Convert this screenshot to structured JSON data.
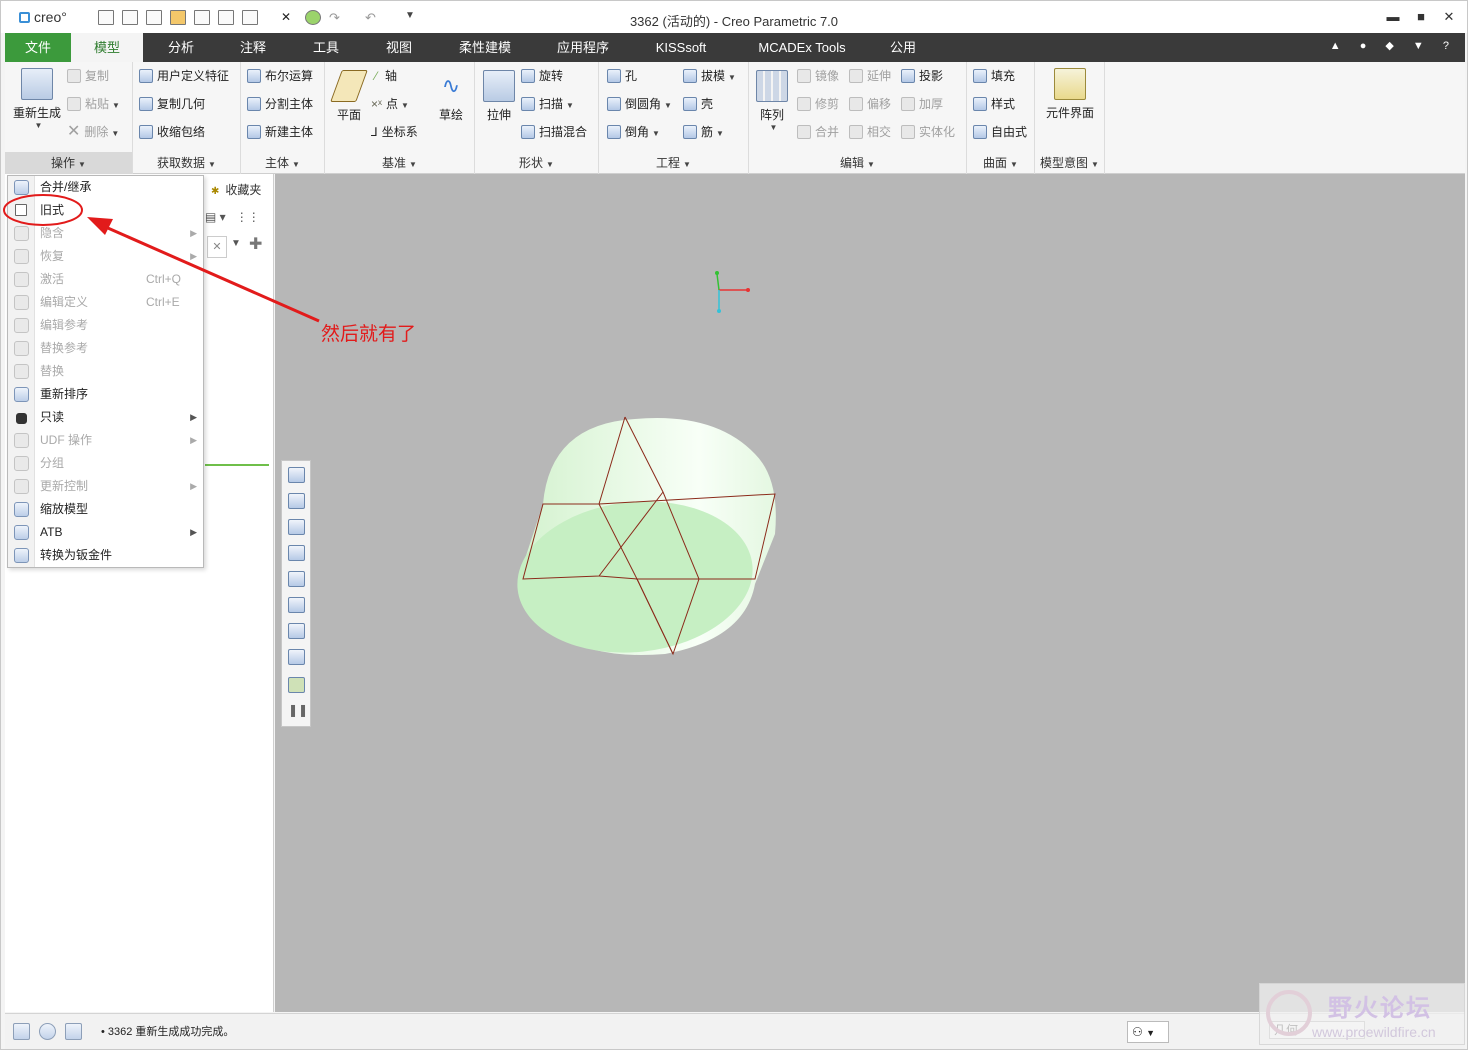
{
  "titlebar": {
    "logo": "creo°",
    "title": "3362 (活动的) - Creo Parametric 7.0",
    "minimize": "▬",
    "maximize": "■",
    "close": "✕"
  },
  "tabs": [
    "文件",
    "模型",
    "分析",
    "注释",
    "工具",
    "视图",
    "柔性建模",
    "应用程序",
    "KISSsoft",
    "MCADEx Tools",
    "公用"
  ],
  "ribbon": {
    "operations": {
      "regen": "重新生成",
      "copy": "复制",
      "paste": "粘贴",
      "delete": "删除",
      "group": "操作"
    },
    "getdata": {
      "udf": "用户定义特征",
      "copygeom": "复制几何",
      "shrinkwrap": "收缩包络",
      "group": "获取数据"
    },
    "body": {
      "boolean": "布尔运算",
      "split": "分割主体",
      "newbody": "新建主体",
      "group": "主体"
    },
    "datum": {
      "plane": "平面",
      "axis": "轴",
      "point": "点",
      "csys": "坐标系",
      "sketch": "草绘",
      "group": "基准"
    },
    "shapes": {
      "extrude": "拉伸",
      "revolve": "旋转",
      "sweep": "扫描",
      "sweepblend": "扫描混合",
      "group": "形状"
    },
    "engineering": {
      "hole": "孔",
      "round": "倒圆角",
      "chamfer": "倒角",
      "draft": "拔模",
      "shell": "壳",
      "rib": "筋",
      "group": "工程"
    },
    "editing": {
      "pattern": "阵列",
      "mirror": "镜像",
      "extend": "延伸",
      "project": "投影",
      "trim": "修剪",
      "offset": "偏移",
      "thicken": "加厚",
      "merge": "合并",
      "intersect": "相交",
      "solidify": "实体化",
      "group": "编辑"
    },
    "surfaces": {
      "fill": "填充",
      "style": "样式",
      "freestyle": "自由式",
      "group": "曲面"
    },
    "intent": {
      "component_interface": "元件界面",
      "group": "模型意图"
    }
  },
  "leftpanel": {
    "favorites": "收藏夹"
  },
  "menu": [
    {
      "label": "合并/继承",
      "shortcut": "",
      "submenu": false,
      "enabled": true
    },
    {
      "label": "旧式",
      "shortcut": "",
      "submenu": false,
      "enabled": true
    },
    {
      "label": "隐含",
      "shortcut": "",
      "submenu": true,
      "enabled": false
    },
    {
      "label": "恢复",
      "shortcut": "",
      "submenu": true,
      "enabled": false
    },
    {
      "label": "激活",
      "shortcut": "Ctrl+Q",
      "submenu": false,
      "enabled": false
    },
    {
      "label": "编辑定义",
      "shortcut": "Ctrl+E",
      "submenu": false,
      "enabled": false
    },
    {
      "label": "编辑参考",
      "shortcut": "",
      "submenu": false,
      "enabled": false
    },
    {
      "label": "替换参考",
      "shortcut": "",
      "submenu": false,
      "enabled": false
    },
    {
      "label": "替换",
      "shortcut": "",
      "submenu": false,
      "enabled": false
    },
    {
      "label": "重新排序",
      "shortcut": "",
      "submenu": false,
      "enabled": true
    },
    {
      "label": "只读",
      "shortcut": "",
      "submenu": true,
      "enabled": true
    },
    {
      "label": "UDF 操作",
      "shortcut": "",
      "submenu": true,
      "enabled": false
    },
    {
      "label": "分组",
      "shortcut": "",
      "submenu": false,
      "enabled": false
    },
    {
      "label": "更新控制",
      "shortcut": "",
      "submenu": true,
      "enabled": false
    },
    {
      "label": "缩放模型",
      "shortcut": "",
      "submenu": false,
      "enabled": true
    },
    {
      "label": "ATB",
      "shortcut": "",
      "submenu": true,
      "enabled": true
    },
    {
      "label": "转换为钣金件",
      "shortcut": "",
      "submenu": false,
      "enabled": true
    }
  ],
  "annotation": {
    "text": "然后就有了",
    "color": "#e21b1b"
  },
  "status": {
    "message": "• 3362 重新生成成功完成。",
    "filter": "几何"
  },
  "watermark": {
    "title": "野火论坛",
    "url": "www.proewildfire.cn"
  },
  "colors": {
    "file_tab": "#3c9a3c",
    "tabbar": "#3a3a3a",
    "viewport": "#b7b7b7",
    "model_fill": "#c6efc3",
    "model_edge": "#8b2a1a"
  }
}
